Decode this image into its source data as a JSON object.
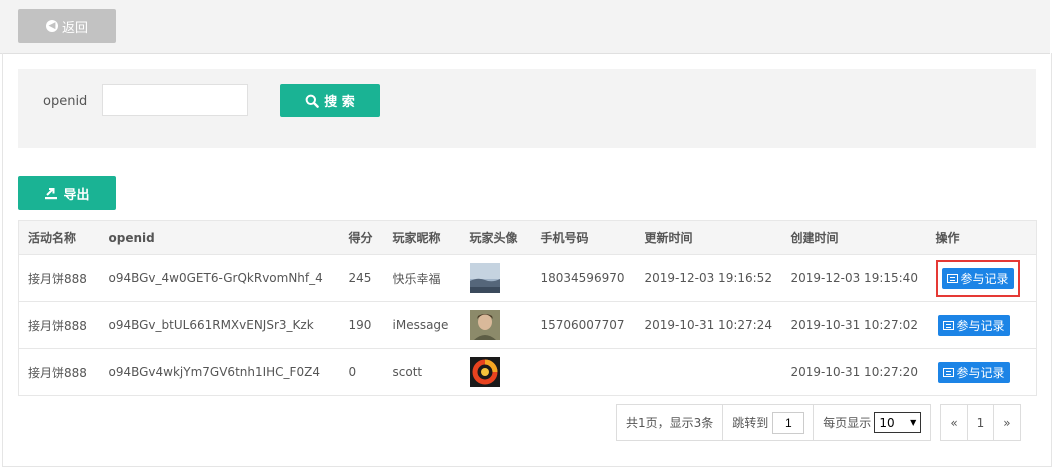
{
  "topbar": {
    "back_label": "返回"
  },
  "search": {
    "label": "openid",
    "value": "",
    "placeholder": "",
    "button_label": "搜 索"
  },
  "toolbar": {
    "export_label": "导出"
  },
  "table": {
    "headers": [
      "活动名称",
      "openid",
      "得分",
      "玩家昵称",
      "玩家头像",
      "手机号码",
      "更新时间",
      "创建时间",
      "操作"
    ],
    "rows": [
      {
        "activity": "接月饼888",
        "openid": "o94BGv_4w0GET6-GrQkRvomNhf_4",
        "score": "245",
        "nickname": "快乐幸福",
        "avatar": "landscape-photo",
        "phone": "18034596970",
        "updated": "2019-12-03 19:16:52",
        "created": "2019-12-03 19:15:40",
        "action": "参与记录"
      },
      {
        "activity": "接月饼888",
        "openid": "o94BGv_btUL661RMXvENJSr3_Kzk",
        "score": "190",
        "nickname": "iMessage",
        "avatar": "person-photo",
        "phone": "15706007707",
        "updated": "2019-10-31 10:27:24",
        "created": "2019-10-31 10:27:02",
        "action": "参与记录"
      },
      {
        "activity": "接月饼888",
        "openid": "o94BGv4wkjYm7GV6tnh1IHC_F0Z4",
        "score": "0",
        "nickname": "scott",
        "avatar": "logo-icon",
        "phone": "",
        "updated": "",
        "created": "2019-10-31 10:27:20",
        "action": "参与记录"
      }
    ]
  },
  "pagination": {
    "summary": "共1页，显示3条",
    "jump_label": "跳转到",
    "jump_value": "1",
    "page_size_label": "每页显示",
    "page_size_value": "10",
    "prev": "«",
    "current": "1",
    "next": "»"
  },
  "colors": {
    "primary": "#1ab394",
    "action": "#1c84e6",
    "highlight": "#e53935",
    "back": "#c2c2c2"
  }
}
